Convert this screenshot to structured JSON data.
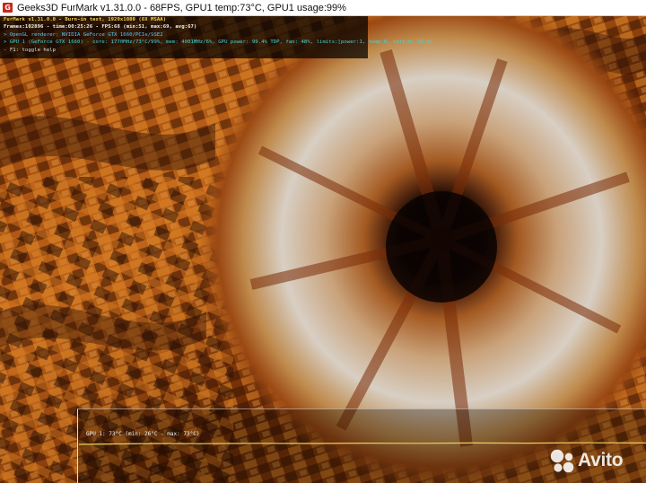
{
  "window": {
    "title": "Geeks3D FurMark v1.31.0.0 - 68FPS, GPU1 temp:73°C, GPU1 usage:99%",
    "icon": "furmark-app-icon"
  },
  "hud": {
    "lines": [
      "FurMark v1.31.0.0 - Burn-in test, 1920x1080 (8X MSAA)",
      "Frames:102896 - time:00:25:26 - FPS:68 (min:51, max:69, avg:67)",
      "> OpenGL renderer: NVIDIA GeForce GTX 1660/PCIe/SSE2",
      "> GPU 1 (GeForce GTX 1660) - core: 1770MHz/73°C/99%, mem: 4001MHz/6%, GPU power: 99.4% TDP, fan: 48%, limits:[power:1, temp:0, volt:0, OV:0]",
      "- F1: toggle help"
    ],
    "colors": {
      "title": "#f2d24b",
      "stats": "#f0f0f0",
      "renderer": "#5cc8ff",
      "gpu": "#44d6d6",
      "help": "#e0e0e0"
    }
  },
  "graph": {
    "label": "GPU 1: 73°C (min: 26°C - max: 73°C)",
    "line_color": "#e8d060"
  },
  "watermark": {
    "text": "Avito",
    "icon": "avito-logo-icon"
  }
}
